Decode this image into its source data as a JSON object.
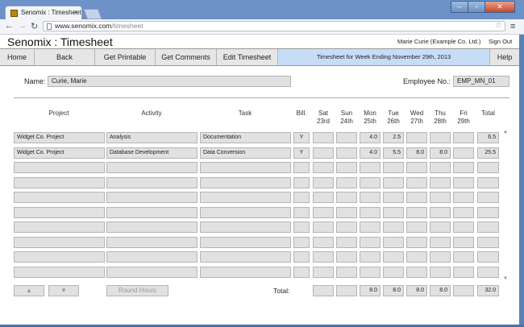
{
  "browser": {
    "tab_title": "Senomix : Timesheet",
    "url_host": "www.senomix.com",
    "url_path": "/timesheet"
  },
  "app": {
    "brand": "Senomix : Timesheet",
    "user": "Marie Curie  (Example Co. Ltd.)",
    "sign_out": "Sign Out"
  },
  "nav": {
    "home": "Home",
    "back": "Back",
    "get_printable": "Get Printable",
    "get_comments": "Get Comments",
    "edit_timesheet": "Edit Timesheet",
    "week": "Timesheet for Week Ending November 29th, 2013",
    "help": "Help"
  },
  "form": {
    "name_label": "Name:",
    "name_value": "Curie, Marie",
    "employee_label": "Employee No.:",
    "employee_value": "EMP_MN_01"
  },
  "columns": {
    "project": "Project",
    "activity": "Activity",
    "task": "Task",
    "bill": "Bill.",
    "days": [
      {
        "day": "Sat",
        "date": "23rd"
      },
      {
        "day": "Sun",
        "date": "24th"
      },
      {
        "day": "Mon",
        "date": "25th"
      },
      {
        "day": "Tue",
        "date": "26th"
      },
      {
        "day": "Wed",
        "date": "27th"
      },
      {
        "day": "Thu",
        "date": "28th"
      },
      {
        "day": "Fri",
        "date": "29th"
      }
    ],
    "total": "Total"
  },
  "rows": [
    {
      "project": "Widget Co. Project",
      "activity": "Analysis",
      "task": "Documentation",
      "bill": "Y",
      "hours": [
        "",
        "",
        "4.0",
        "2.5",
        "",
        "",
        ""
      ],
      "total": "6.5"
    },
    {
      "project": "Widget Co. Project",
      "activity": "Database Development",
      "task": "Data Conversion",
      "bill": "Y",
      "hours": [
        "",
        "",
        "4.0",
        "5.5",
        "8.0",
        "8.0",
        ""
      ],
      "total": "25.5"
    },
    {
      "project": "",
      "activity": "",
      "task": "",
      "bill": "",
      "hours": [
        "",
        "",
        "",
        "",
        "",
        "",
        ""
      ],
      "total": ""
    },
    {
      "project": "",
      "activity": "",
      "task": "",
      "bill": "",
      "hours": [
        "",
        "",
        "",
        "",
        "",
        "",
        ""
      ],
      "total": ""
    },
    {
      "project": "",
      "activity": "",
      "task": "",
      "bill": "",
      "hours": [
        "",
        "",
        "",
        "",
        "",
        "",
        ""
      ],
      "total": ""
    },
    {
      "project": "",
      "activity": "",
      "task": "",
      "bill": "",
      "hours": [
        "",
        "",
        "",
        "",
        "",
        "",
        ""
      ],
      "total": ""
    },
    {
      "project": "",
      "activity": "",
      "task": "",
      "bill": "",
      "hours": [
        "",
        "",
        "",
        "",
        "",
        "",
        ""
      ],
      "total": ""
    },
    {
      "project": "",
      "activity": "",
      "task": "",
      "bill": "",
      "hours": [
        "",
        "",
        "",
        "",
        "",
        "",
        ""
      ],
      "total": ""
    },
    {
      "project": "",
      "activity": "",
      "task": "",
      "bill": "",
      "hours": [
        "",
        "",
        "",
        "",
        "",
        "",
        ""
      ],
      "total": ""
    },
    {
      "project": "",
      "activity": "",
      "task": "",
      "bill": "",
      "hours": [
        "",
        "",
        "",
        "",
        "",
        "",
        ""
      ],
      "total": ""
    }
  ],
  "footer": {
    "up_glyph": "▲",
    "down_glyph": "▼",
    "round_hours": "Round Hours",
    "total_label": "Total:",
    "day_totals": [
      "",
      "",
      "8.0",
      "8.0",
      "8.0",
      "8.0",
      ""
    ],
    "grand_total": "32.0"
  },
  "icons": {
    "back": "back-arrow-icon",
    "forward": "forward-arrow-icon",
    "reload": "reload-icon",
    "star": "bookmark-star-icon",
    "menu": "menu-icon"
  }
}
